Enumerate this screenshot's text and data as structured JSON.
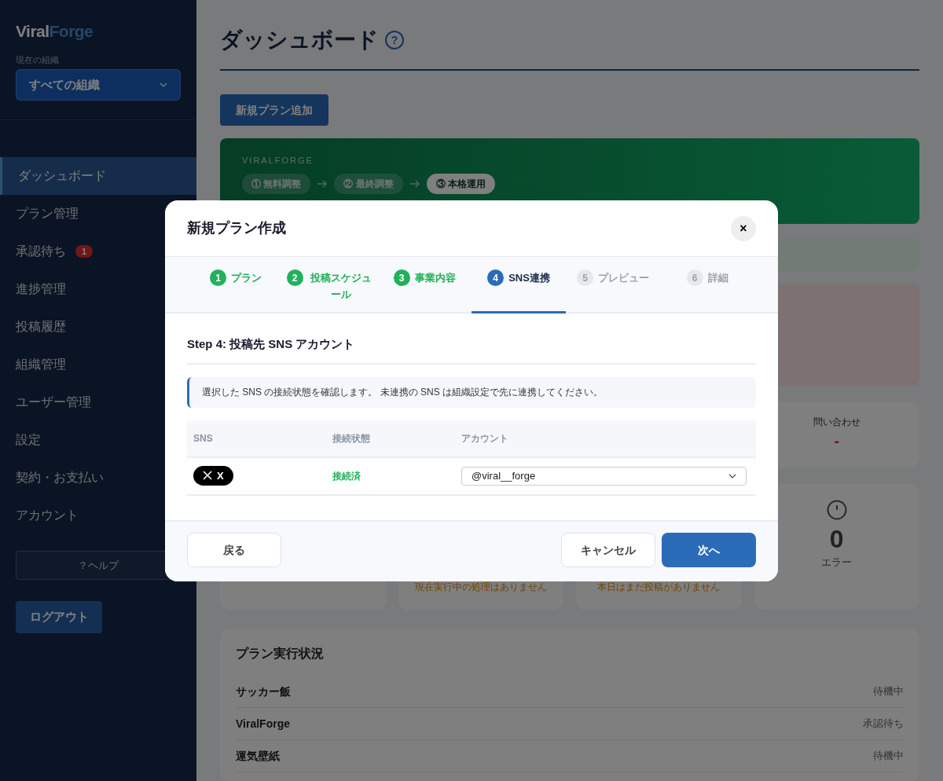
{
  "sidebar": {
    "logo": {
      "part1": "Viral",
      "part2": "Forge"
    },
    "org_label": "現在の組織",
    "org_select": "すべての組織",
    "items": [
      {
        "label": "ダッシュボード",
        "selected": true
      },
      {
        "label": "プラン管理",
        "selected": false
      },
      {
        "label": "承認待ち",
        "selected": false,
        "badge": "1"
      },
      {
        "label": "進捗管理",
        "selected": false
      },
      {
        "label": "投稿履歴",
        "selected": false
      },
      {
        "label": "組織管理",
        "selected": false
      },
      {
        "label": "ユーザー管理",
        "selected": false
      },
      {
        "label": "設定",
        "selected": false
      },
      {
        "label": "契約・お支払い",
        "selected": false
      },
      {
        "label": "アカウント",
        "selected": false
      }
    ],
    "help": "？ヘルプ",
    "logout": "ログアウト"
  },
  "page": {
    "title": "ダッシュボード",
    "help_icon": "?",
    "add_button": "新規プラン追加",
    "banner": {
      "brand": "VIRALFORGE",
      "stages": [
        {
          "label": "① 無料調整",
          "selected": false
        },
        {
          "label": "② 最終調整",
          "selected": false
        },
        {
          "label": "③ 本格運用",
          "selected": true
        }
      ]
    },
    "stat_cards": [
      {
        "label": "問い合わせ",
        "value": "-"
      }
    ],
    "status_cards": [
      {
        "note": "現在実行中の処理はありません"
      },
      {
        "note": "本日はまだ投稿がありません"
      },
      {
        "value": "0",
        "label": "エラー"
      }
    ],
    "plan_status": {
      "title": "プラン実行状況",
      "rows": [
        {
          "name": "サッカー飯",
          "status": "待機中"
        },
        {
          "name": "ViralForge",
          "status": "承認待ち"
        },
        {
          "name": "運気壁紙",
          "status": "待機中"
        }
      ]
    }
  },
  "modal": {
    "title": "新規プラン作成",
    "close": "×",
    "steps": [
      {
        "number": "1",
        "label": "プラン",
        "done": true,
        "selected": false
      },
      {
        "number": "2",
        "label": "投稿スケジュール",
        "done": true,
        "selected": false
      },
      {
        "number": "3",
        "label": "事業内容",
        "done": true,
        "selected": false
      },
      {
        "number": "4",
        "label": "SNS連携",
        "done": false,
        "selected": true
      },
      {
        "number": "5",
        "label": "プレビュー",
        "done": false,
        "selected": false
      },
      {
        "number": "6",
        "label": "詳細",
        "done": false,
        "selected": false
      }
    ],
    "section_title": "Step 4: 投稿先 SNS アカウント",
    "info": "選択した SNS の接続状態を確認します。 未連携の SNS は組織設定で先に連携してください。",
    "table": {
      "columns": [
        "SNS",
        "接続状態",
        "アカウント"
      ],
      "rows": [
        {
          "sns": "X",
          "status": "接続済",
          "connected": true,
          "account": "@viral__forge"
        }
      ]
    },
    "back": "戻る",
    "cancel": "キャンセル",
    "next": "次へ"
  }
}
